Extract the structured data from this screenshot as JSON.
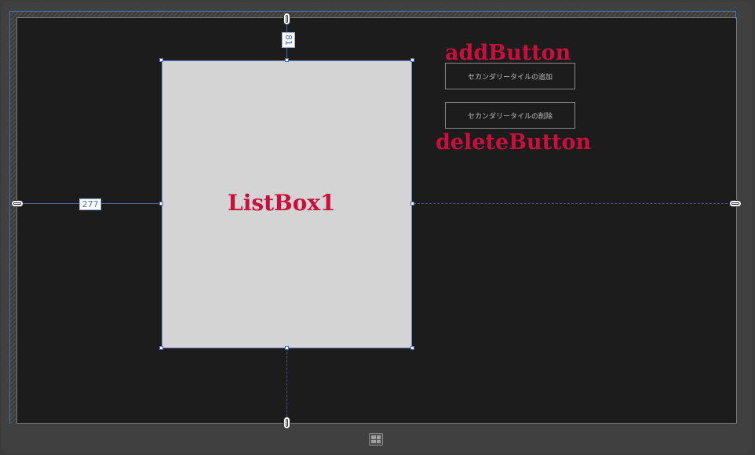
{
  "designer": {
    "listbox": {
      "name": "ListBox1"
    },
    "add_button": {
      "label": "セカンダリータイルの追加",
      "annotation": "addButton"
    },
    "delete_button": {
      "label": "セカンダリータイルの削除",
      "annotation": "deleteButton"
    },
    "margins": {
      "top": "81",
      "left": "277"
    },
    "accent_color": "#c8103e",
    "guide_color": "#4a6fb5"
  },
  "icons": {
    "anchor_pin": "pin-anchor-icon",
    "windows_button": "windows-logo-icon"
  }
}
